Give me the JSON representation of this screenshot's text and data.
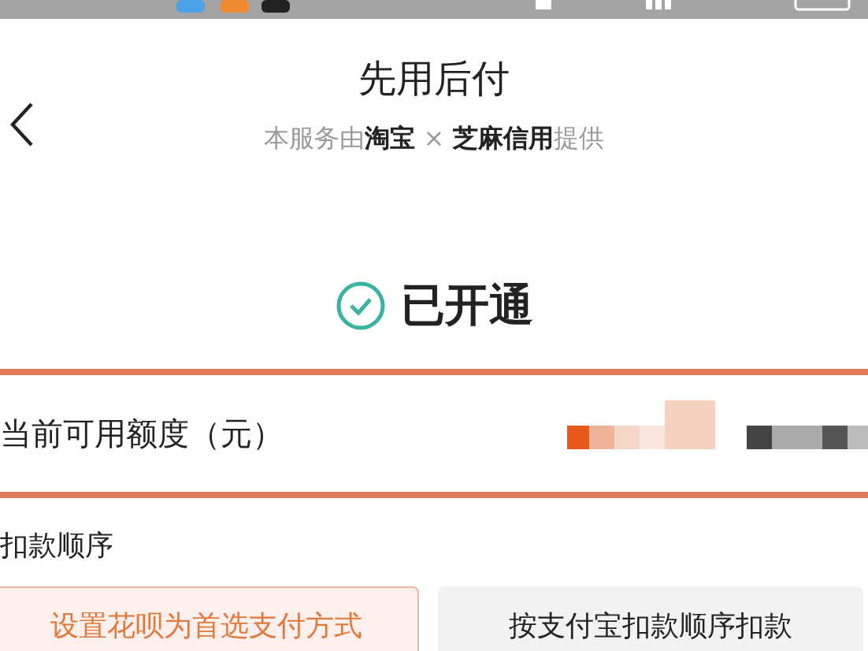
{
  "header": {
    "title": "先用后付",
    "subtitle": "本服务由**淘宝** × **芝麻信用**提供"
  },
  "status": {
    "text": "已开通"
  },
  "credit": {
    "label": "当前可用额度（元）"
  },
  "deduction": {
    "title": "扣款顺序",
    "options": [
      {
        "label": "设置花呗为首选支付方式",
        "selected": true
      },
      {
        "label": "按支付宝扣款顺序扣款",
        "selected": false
      }
    ]
  }
}
